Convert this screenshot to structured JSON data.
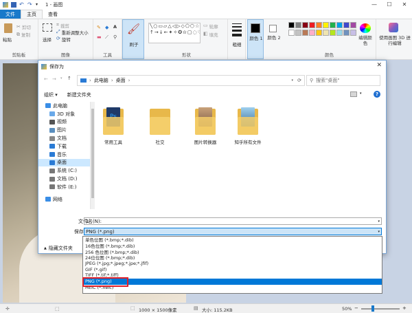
{
  "window": {
    "title": "1 - 画图",
    "quick_access": [
      "save-icon",
      "undo-icon",
      "redo-icon"
    ],
    "controls": [
      "—",
      "☐",
      "✕"
    ]
  },
  "menu": {
    "file": "文件",
    "home": "主页",
    "view": "查看"
  },
  "ribbon": {
    "clipboard": {
      "paste": "粘贴",
      "cut": "剪切",
      "copy": "复制",
      "label": "剪贴板"
    },
    "image": {
      "select": "选择",
      "crop": "裁剪",
      "resize": "重新调整大小",
      "rotate": "旋转",
      "label": "图像"
    },
    "tools": {
      "label": "工具",
      "text_icon": "A"
    },
    "brushes": {
      "label": "刷子"
    },
    "shapes": {
      "outline": "轮廓",
      "fill": "填充",
      "label": "形状"
    },
    "size": {
      "label": "粗细"
    },
    "color1": {
      "label": "颜色 1"
    },
    "color2": {
      "label": "颜色 2"
    },
    "colors": {
      "label": "颜色",
      "edit": "编辑颜色",
      "paint3d": "使用画图 3D 进行编辑"
    },
    "palette": [
      "#000000",
      "#7f7f7f",
      "#880015",
      "#ed1c24",
      "#ff7f27",
      "#fff200",
      "#22b14c",
      "#00a2e8",
      "#3f48cc",
      "#a349a4",
      "#ffffff",
      "#c3c3c3",
      "#b97a57",
      "#ffaec9",
      "#ffc90e",
      "#efe4b0",
      "#b5e61d",
      "#99d9ea",
      "#7092be",
      "#c8bfe7"
    ]
  },
  "dialog": {
    "title": "保存为",
    "breadcrumb": [
      "此电脑",
      "桌面"
    ],
    "search_placeholder": "搜索\"桌面\"",
    "organize": "组织 ▾",
    "new_folder": "新建文件夹",
    "nav_items": [
      {
        "label": "此电脑",
        "icon": "computer-icon",
        "indent": 0
      },
      {
        "label": "3D 对象",
        "icon": "3d-objects-icon",
        "indent": 1
      },
      {
        "label": "视频",
        "icon": "video-icon",
        "indent": 1
      },
      {
        "label": "图片",
        "icon": "pictures-icon",
        "indent": 1
      },
      {
        "label": "文档",
        "icon": "documents-icon",
        "indent": 1
      },
      {
        "label": "下载",
        "icon": "download-icon",
        "indent": 1
      },
      {
        "label": "音乐",
        "icon": "music-icon",
        "indent": 1
      },
      {
        "label": "桌面",
        "icon": "desktop-icon",
        "indent": 1,
        "selected": true
      },
      {
        "label": "系统 (C:)",
        "icon": "drive-icon",
        "indent": 1
      },
      {
        "label": "文档 (D:)",
        "icon": "drive-icon",
        "indent": 1
      },
      {
        "label": "软件 (E:)",
        "icon": "drive-icon",
        "indent": 1
      },
      {
        "label": "网络",
        "icon": "network-icon",
        "indent": 0
      }
    ],
    "files": [
      {
        "name": "常用工具",
        "icon": "photoshop-folder-icon"
      },
      {
        "name": "社交",
        "icon": "folder-icon"
      },
      {
        "name": "图片转换器",
        "icon": "photo-folder-icon"
      },
      {
        "name": "知乎所有文件",
        "icon": "photo-folder-icon"
      }
    ],
    "filename_label": "文件名(N):",
    "filename_value": "1",
    "filetype_label": "保存类型(T):",
    "filetype_value": "PNG (*.png)",
    "hide_folders": "隐藏文件夹",
    "filetype_options": [
      "单色位图 (*.bmp;*.dib)",
      "16色位图 (*.bmp;*.dib)",
      "256 色位图 (*.bmp;*.dib)",
      "24位位图 (*.bmp;*.dib)",
      "JPEG (*.jpg;*.jpeg;*.jpe;*.jfif)",
      "GIF (*.gif)",
      "TIFF (*.tif;*.tiff)",
      "PNG (*.png)",
      "HEIC (*.heic)"
    ],
    "selected_option": 7
  },
  "status": {
    "dimensions": "1000 × 1500像素",
    "size": "大小: 115.2KB",
    "zoom": "50%",
    "zoom_fraction": 0.3
  }
}
